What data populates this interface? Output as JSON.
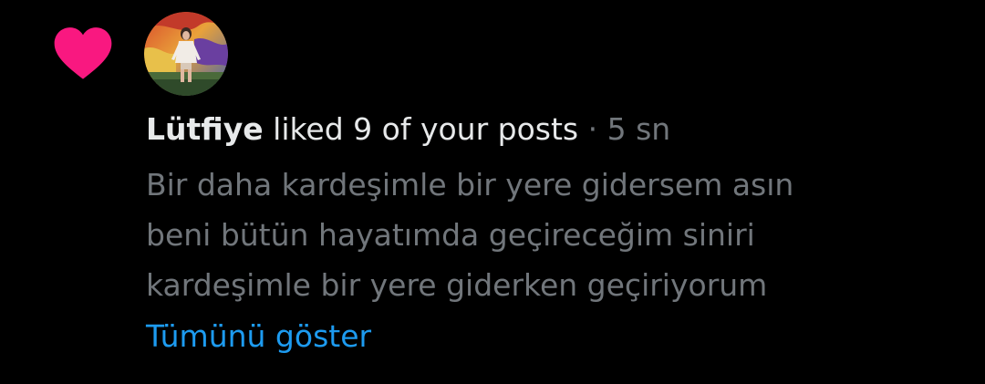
{
  "colors": {
    "background": "#000000",
    "heart": "#f91880",
    "primary_text": "#e7e9ea",
    "secondary_text": "#71767b",
    "link": "#1d9bf0"
  },
  "notification": {
    "icon": "heart-icon",
    "user_name": "Lütfiye",
    "action_text": " liked 9 of your posts",
    "separator": " · ",
    "time": "5 sn",
    "post_lines": [
      "Bir daha kardeşimle bir yere gidersem asın",
      "beni bütün hayatımda geçireceğim siniri",
      "kardeşimle bir yere giderken geçiriyorum"
    ],
    "show_more_label": "Tümünü göster"
  }
}
